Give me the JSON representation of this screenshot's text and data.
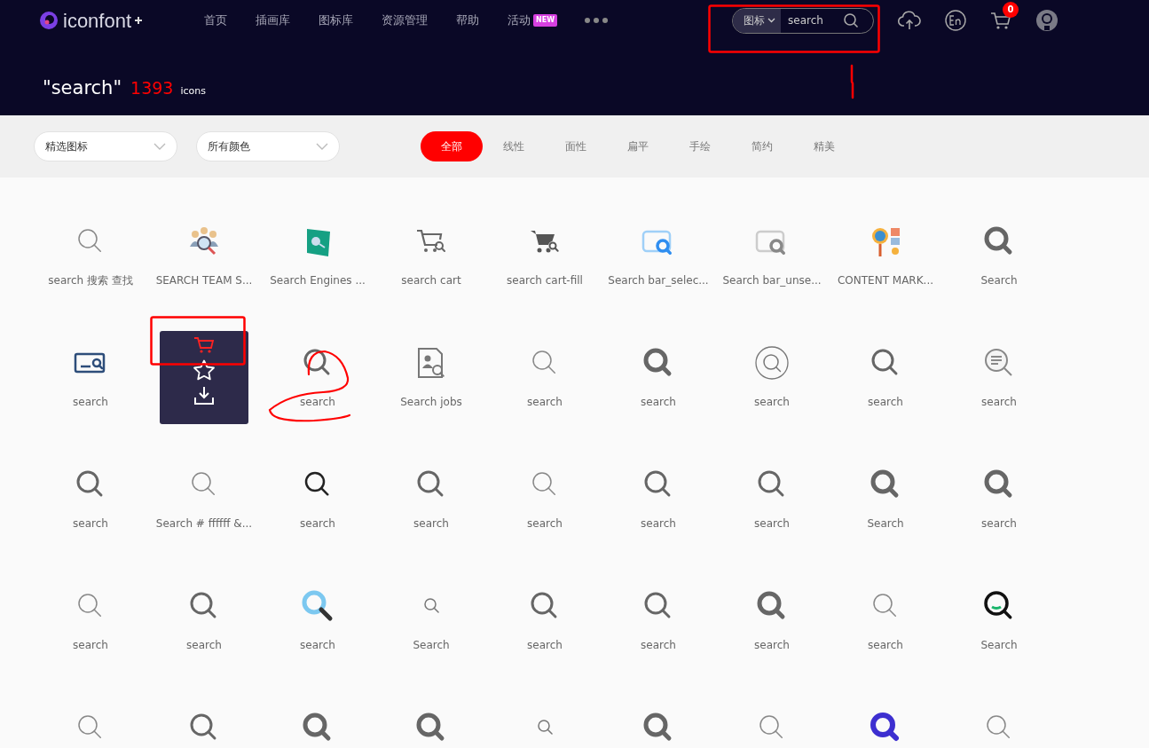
{
  "header": {
    "logo": "iconfont",
    "nav": [
      {
        "label": "首页"
      },
      {
        "label": "插画库"
      },
      {
        "label": "图标库"
      },
      {
        "label": "资源管理"
      },
      {
        "label": "帮助"
      },
      {
        "label": "活动",
        "badge": "NEW"
      }
    ],
    "search": {
      "scope": "图标",
      "value": "search"
    },
    "cart_count": "0"
  },
  "result": {
    "query": "\"search\"",
    "count": "1393",
    "unit": "icons"
  },
  "filters": {
    "dropdowns": [
      {
        "value": "精选图标"
      },
      {
        "value": "所有颜色"
      }
    ],
    "tabs": [
      {
        "label": "全部",
        "selected": true
      },
      {
        "label": "线性",
        "selected": false
      },
      {
        "label": "面性",
        "selected": false
      },
      {
        "label": "扁平",
        "selected": false
      },
      {
        "label": "手绘",
        "selected": false
      },
      {
        "label": "简约",
        "selected": false
      },
      {
        "label": "精美",
        "selected": false
      }
    ]
  },
  "icons": [
    {
      "kind": "thin",
      "label": "search 搜索 查找",
      "hovered": false
    },
    {
      "kind": "team",
      "label": "SEARCH TEAM S...",
      "hovered": false
    },
    {
      "kind": "engine",
      "label": "Search Engines ...",
      "hovered": false
    },
    {
      "kind": "cart",
      "label": "search cart",
      "hovered": false
    },
    {
      "kind": "cart-fill",
      "label": "search cart-fill",
      "hovered": false
    },
    {
      "kind": "bar-blue",
      "label": "Search bar_selec...",
      "hovered": false
    },
    {
      "kind": "bar-gray",
      "label": "Search bar_unse...",
      "hovered": false
    },
    {
      "kind": "content",
      "label": "CONTENT MARK...",
      "hovered": false
    },
    {
      "kind": "bold",
      "label": "Search",
      "hovered": false
    },
    {
      "kind": "card",
      "label": "search",
      "hovered": false
    },
    {
      "hovered": true
    },
    {
      "kind": "medium",
      "label": "search",
      "hovered": false
    },
    {
      "kind": "jobs",
      "label": "Search jobs",
      "hovered": false
    },
    {
      "kind": "thin",
      "label": "search",
      "hovered": false
    },
    {
      "kind": "bold",
      "label": "search",
      "hovered": false
    },
    {
      "kind": "ring",
      "label": "search",
      "hovered": false
    },
    {
      "kind": "medium",
      "label": "search",
      "hovered": false
    },
    {
      "kind": "doc",
      "label": "search",
      "hovered": false
    },
    {
      "kind": "medium",
      "label": "search",
      "hovered": false
    },
    {
      "kind": "thin",
      "label": "Search # ffffff &...",
      "hovered": false
    },
    {
      "kind": "dark",
      "label": "search",
      "hovered": false
    },
    {
      "kind": "medium",
      "label": "search",
      "hovered": false
    },
    {
      "kind": "thin",
      "label": "search",
      "hovered": false
    },
    {
      "kind": "medium",
      "label": "search",
      "hovered": false
    },
    {
      "kind": "medium",
      "label": "search",
      "hovered": false
    },
    {
      "kind": "bold",
      "label": "Search",
      "hovered": false
    },
    {
      "kind": "bold",
      "label": "search",
      "hovered": false
    },
    {
      "kind": "thin",
      "label": "search",
      "hovered": false
    },
    {
      "kind": "medium",
      "label": "search",
      "hovered": false
    },
    {
      "kind": "blue",
      "label": "search",
      "hovered": false
    },
    {
      "kind": "small",
      "label": "Search",
      "hovered": false
    },
    {
      "kind": "medium",
      "label": "search",
      "hovered": false
    },
    {
      "kind": "medium",
      "label": "search",
      "hovered": false
    },
    {
      "kind": "bold",
      "label": "search",
      "hovered": false
    },
    {
      "kind": "thin",
      "label": "search",
      "hovered": false
    },
    {
      "kind": "green",
      "label": "Search",
      "hovered": false
    },
    {
      "kind": "thin",
      "hovered": false
    },
    {
      "kind": "medium",
      "hovered": false
    },
    {
      "kind": "bold",
      "hovered": false
    },
    {
      "kind": "bold",
      "hovered": false
    },
    {
      "kind": "small",
      "hovered": false
    },
    {
      "kind": "bold",
      "hovered": false
    },
    {
      "kind": "thin",
      "hovered": false
    },
    {
      "kind": "purple",
      "hovered": false
    },
    {
      "kind": "thin",
      "hovered": false
    }
  ],
  "annotations": [
    {
      "kind": "rect"
    },
    {
      "kind": "stroke"
    },
    {
      "kind": "rect"
    },
    {
      "kind": "scribble"
    }
  ]
}
